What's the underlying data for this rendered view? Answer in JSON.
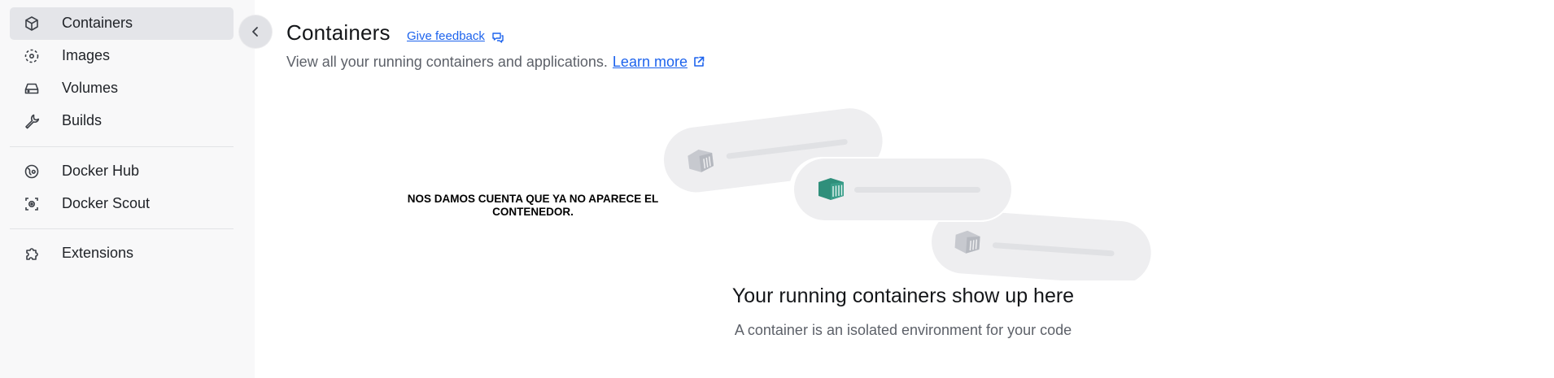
{
  "sidebar": {
    "items": [
      {
        "label": "Containers",
        "icon": "cube-icon"
      },
      {
        "label": "Images",
        "icon": "images-icon"
      },
      {
        "label": "Volumes",
        "icon": "volumes-icon"
      },
      {
        "label": "Builds",
        "icon": "wrench-icon"
      },
      {
        "label": "Docker Hub",
        "icon": "docker-hub-icon"
      },
      {
        "label": "Docker Scout",
        "icon": "docker-scout-icon"
      },
      {
        "label": "Extensions",
        "icon": "puzzle-icon"
      }
    ],
    "active": "Containers"
  },
  "header": {
    "title": "Containers",
    "feedback_label": "Give feedback",
    "subtitle": "View all your running containers and applications.",
    "learn_more": "Learn more"
  },
  "annotation": {
    "text": "NOS DAMOS CUENTA QUE YA NO APARECE EL CONTENEDOR."
  },
  "empty_state": {
    "title": "Your running containers show up here",
    "subtitle": "A container is an isolated environment for your code"
  },
  "colors": {
    "accent": "#1d63ed",
    "active_container": "#3a9e8a",
    "sidebar_bg": "#f8f8f9",
    "active_item_bg": "#e4e5e9"
  }
}
